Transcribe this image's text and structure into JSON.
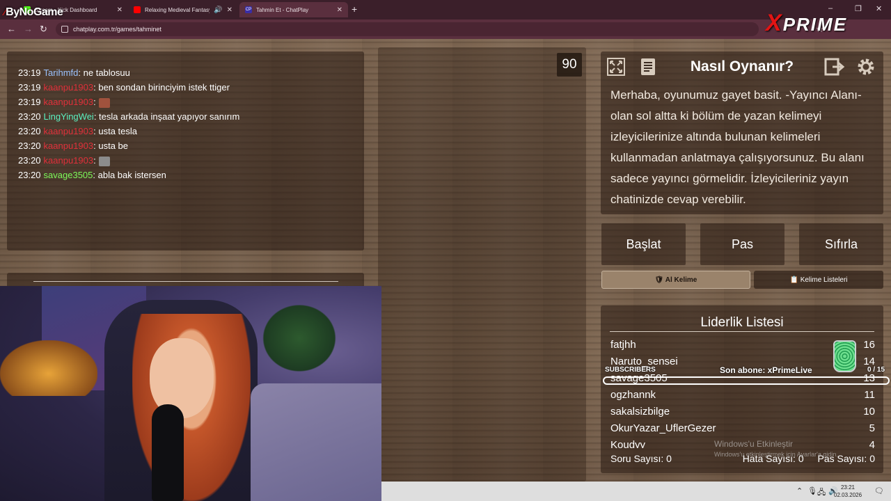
{
  "brand_left": "ByNoGame",
  "brand_right": "PRIME",
  "brand_right_prefix": "X",
  "tabs": [
    {
      "title": "Stream - Kick Dashboard",
      "favicon_color": "#53fc18"
    },
    {
      "title": "Relaxing Medieval Fantasy",
      "favicon_color": "#ff0000"
    },
    {
      "title": "Tahmin Et - ChatPlay",
      "favicon_color": "#3a2ea6",
      "favicon": "CP"
    }
  ],
  "window_controls": {
    "minimize": "–",
    "maximize": "❐",
    "close": "✕"
  },
  "address": {
    "url": "chatplay.com.tr/games/tahminet"
  },
  "chat": [
    {
      "time": "23:19",
      "user": "Tarihmfd",
      "color": "#9bc3ff",
      "msg": ": ne tablosuu"
    },
    {
      "time": "23:19",
      "user": "kaanpu1903",
      "color": "#e0303a",
      "msg": ": ben sondan birinciyim istek ttiger"
    },
    {
      "time": "23:19",
      "user": "kaanpu1903",
      "color": "#e0303a",
      "msg": ":",
      "emote_color": "#a0523d"
    },
    {
      "time": "23:20",
      "user": "LingYingWei",
      "color": "#5af0c0",
      "msg": ": tesla arkada inşaat yapıyor sanırım"
    },
    {
      "time": "23:20",
      "user": "kaanpu1903",
      "color": "#e0303a",
      "msg": ": usta tesla"
    },
    {
      "time": "23:20",
      "user": "kaanpu1903",
      "color": "#e0303a",
      "msg": ": usta be"
    },
    {
      "time": "23:20",
      "user": "kaanpu1903",
      "color": "#e0303a",
      "msg": ":",
      "emote_color": "#8c8c8c"
    },
    {
      "time": "23:20",
      "user": "savage3505",
      "color": "#7dfa5a",
      "msg": ": abla bak istersen"
    }
  ],
  "timer": "90",
  "howto": {
    "title": "Nasıl Oynanır?",
    "text": "Merhaba, oyunumuz gayet basit. -Yayıncı Alanı- olan sol altta ki bölüm de yazan kelimeyi izleyicilerinize altında bulunan kelimeleri kullanmadan anlatmaya çalışıyorsunuz. Bu alanı sadece yayıncı görmelidir. İzleyicileriniz yayın chatinizde cevap verebilir."
  },
  "controls": {
    "start": "Başlat",
    "pass": "Pas",
    "reset": "Sıfırla",
    "get_word": "🛡 Al Kelime",
    "word_lists": "📋 Kelime Listeleri"
  },
  "leaderboard": {
    "title": "Liderlik Listesi",
    "rows": [
      {
        "name": "fatjhh",
        "score": "16"
      },
      {
        "name": "Naruto_sensei",
        "score": "14"
      },
      {
        "name": "savage3505",
        "score": "13"
      },
      {
        "name": "ogzhannk",
        "score": "11"
      },
      {
        "name": "sakalsizbilge",
        "score": "10"
      },
      {
        "name": "OkurYazar_UflerGezer",
        "score": "5"
      },
      {
        "name": "Koudyy",
        "score": "4"
      }
    ],
    "question_count": "Soru Sayısı: 0",
    "error_count": "Hata Sayısı: 0",
    "pass_count": "Pas Sayısı: 0"
  },
  "subscribers": {
    "label": "SUBSCRIBERS",
    "last": "Son abone: xPrimeLive",
    "count": "0 / 15"
  },
  "windows_activation": {
    "title": "Windows'u Etkinleştir",
    "sub": "Windows'u etkinleştirmek için Ayarlar'a gidin."
  },
  "taskbar": {
    "time": "23:21",
    "date": "02.03.2026"
  }
}
